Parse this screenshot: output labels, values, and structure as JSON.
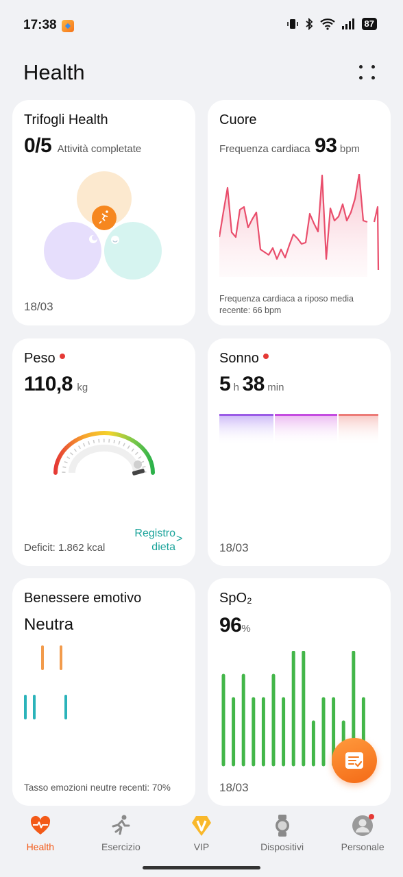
{
  "status_bar": {
    "time": "17:38",
    "battery": "87"
  },
  "header": {
    "title": "Health"
  },
  "cards": {
    "trifogli": {
      "title": "Trifogli Health",
      "value": "0/5",
      "value_label": "Attività completate",
      "date": "18/03",
      "colors": {
        "top": "#fce9cf",
        "left": "#e6defc",
        "right": "#d6f4f0",
        "accent": "#f6871f"
      }
    },
    "cuore": {
      "title": "Cuore",
      "label": "Frequenza cardiaca",
      "value": "93",
      "unit": "bpm",
      "footnote_line1": "Frequenza cardiaca a riposo media",
      "footnote_line2": "recente: 66 bpm",
      "line_color": "#e94e6c"
    },
    "peso": {
      "title": "Peso",
      "value": "110,8",
      "unit": "kg",
      "deficit": "Deficit: 1.862 kcal",
      "link_line1": "Registro",
      "link_line2": "dieta",
      "link_chevron": ">",
      "link_color": "#1aa39a"
    },
    "sonno": {
      "title": "Sonno",
      "hours": "5",
      "hours_unit": "h",
      "minutes": "38",
      "minutes_unit": "min",
      "date": "18/03"
    },
    "benessere": {
      "title": "Benessere emotivo",
      "value": "Neutra",
      "footnote": "Tasso emozioni neutre recenti: 70%",
      "colors": {
        "orange": "#f29b4c",
        "teal": "#2bb3ba"
      }
    },
    "spo2": {
      "title": "SpO₂",
      "value": "96",
      "unit": "%",
      "date": "18/03",
      "bar_color": "#43b649"
    }
  },
  "nav": [
    {
      "label": "Health",
      "icon": "heart-pulse-icon",
      "active": true
    },
    {
      "label": "Esercizio",
      "icon": "running-icon",
      "active": false
    },
    {
      "label": "VIP",
      "icon": "vip-badge-icon",
      "active": false
    },
    {
      "label": "Dispositivi",
      "icon": "watch-icon",
      "active": false
    },
    {
      "label": "Personale",
      "icon": "avatar-icon",
      "active": false
    }
  ]
}
